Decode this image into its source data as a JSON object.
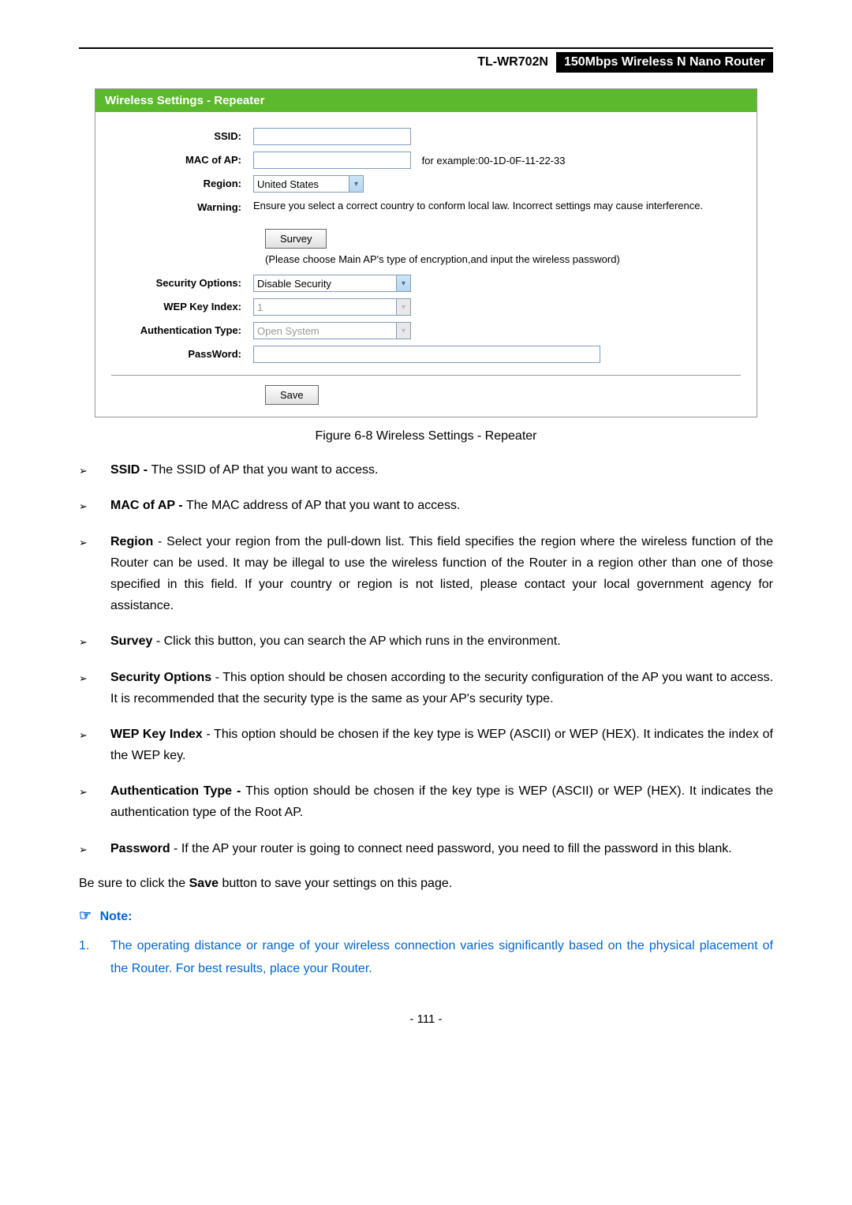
{
  "header": {
    "model": "TL-WR702N",
    "product": "150Mbps Wireless N Nano Router"
  },
  "panel": {
    "title": "Wireless Settings - Repeater",
    "ssid_label": "SSID:",
    "ssid_value": "",
    "mac_label": "MAC of AP:",
    "mac_value": "",
    "mac_example": "for example:00-1D-0F-11-22-33",
    "region_label": "Region:",
    "region_value": "United States",
    "warning_label": "Warning:",
    "warning_text": "Ensure you select a correct country to conform local law. Incorrect settings may cause interference.",
    "survey_btn": "Survey",
    "survey_note": "(Please choose Main AP's type of encryption,and input the wireless password)",
    "security_label": "Security Options:",
    "security_value": "Disable Security",
    "wep_label": "WEP Key Index:",
    "wep_value": "1",
    "auth_label": "Authentication Type:",
    "auth_value": "Open System",
    "password_label": "PassWord:",
    "password_value": "",
    "save_btn": "Save"
  },
  "figure_caption": "Figure 6-8 Wireless Settings - Repeater",
  "bullets": [
    {
      "title": "SSID - ",
      "text": "The SSID of AP that you want to access."
    },
    {
      "title": "MAC of AP - ",
      "text": "The MAC address of AP that you want to access."
    },
    {
      "title": "Region ",
      "dash": "- ",
      "text": "Select your region from the pull-down list. This field specifies the region where the wireless function of the Router can be used. It may be illegal to use the wireless function of the Router in a region other than one of those specified in this field. If your country or region is not listed, please contact your local government agency for assistance."
    },
    {
      "title": "Survey ",
      "dash": "- ",
      "text": "Click this button, you can search the AP which runs in the environment."
    },
    {
      "title": "Security Options ",
      "dash": "- ",
      "text": "This option should be chosen according to the security configuration of the AP you want to access. It is recommended that the security type is the same as your AP's security type."
    },
    {
      "title": "WEP Key Index ",
      "dash": "- ",
      "text": "This option should be chosen if the key type is WEP (ASCII) or WEP (HEX). It indicates the index of the WEP key."
    },
    {
      "title": "Authentication Type - ",
      "text": "This option should be chosen if the key type is WEP (ASCII) or WEP (HEX). It indicates the authentication type of the Root AP."
    },
    {
      "title": "Password ",
      "dash": "- ",
      "text": "If the AP your router is going to connect need password, you need to fill the password in this blank."
    }
  ],
  "save_note_prefix": "Be sure to click the ",
  "save_note_bold": "Save",
  "save_note_suffix": " button to save your settings on this page.",
  "note_label": "Note:",
  "notes": [
    {
      "num": "1.",
      "text": "The operating distance or range of your wireless connection varies significantly based on the physical placement of the Router. For best results, place your Router."
    }
  ],
  "page_number": "- 111 -"
}
